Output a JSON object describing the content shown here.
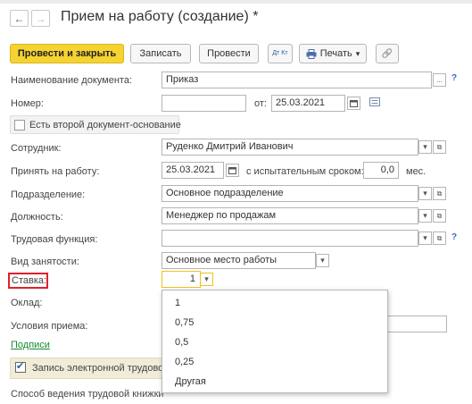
{
  "window": {
    "title": "Прием на работу (создание) *"
  },
  "nav": {
    "back": "←",
    "forward": "→"
  },
  "toolbar": {
    "post_close": "Провести и закрыть",
    "save": "Записать",
    "post": "Провести",
    "dt_kt": "Дт Кт",
    "print": "Печать",
    "print_chevron": "▾",
    "attach_icon": "🔗"
  },
  "form": {
    "doc_name_label": "Наименование документа:",
    "doc_name_value": "Приказ",
    "number_label": "Номер:",
    "number_value": "",
    "from_label": "от:",
    "date_value": "25.03.2021",
    "second_doc_label": "Есть второй документ-основание",
    "employee_label": "Сотрудник:",
    "employee_value": "Руденко Дмитрий Иванович",
    "hired_label": "Принять на работу:",
    "hired_value": "25.03.2021",
    "probation_label": "с испытательным сроком:",
    "probation_value": "0,0",
    "probation_unit": "мес.",
    "department_label": "Подразделение:",
    "department_value": "Основное подразделение",
    "position_label": "Должность:",
    "position_value": "Менеджер по продажам",
    "labor_function_label": "Трудовая функция:",
    "labor_function_value": "",
    "employment_type_label": "Вид занятости:",
    "employment_type_value": "Основное место работы",
    "rate_label": "Ставка:",
    "rate_value": "1",
    "salary_label": "Оклад:",
    "conditions_label": "Условия приема:",
    "signatures_link": "Подписи",
    "electronic_book_label": "Запись электронной трудовой",
    "book_method_label": "Способ ведения трудовой книжки",
    "help": "?",
    "ellipsis": "...",
    "link_icon": "⧉"
  },
  "rate_dropdown": {
    "options": [
      "1",
      "0,75",
      "0,5",
      "0,25",
      "Другая"
    ]
  },
  "colors": {
    "primary_button": "#f5d330",
    "link": "#1a8a2e",
    "highlight": "#e0202a",
    "active_border": "#f0c020"
  }
}
